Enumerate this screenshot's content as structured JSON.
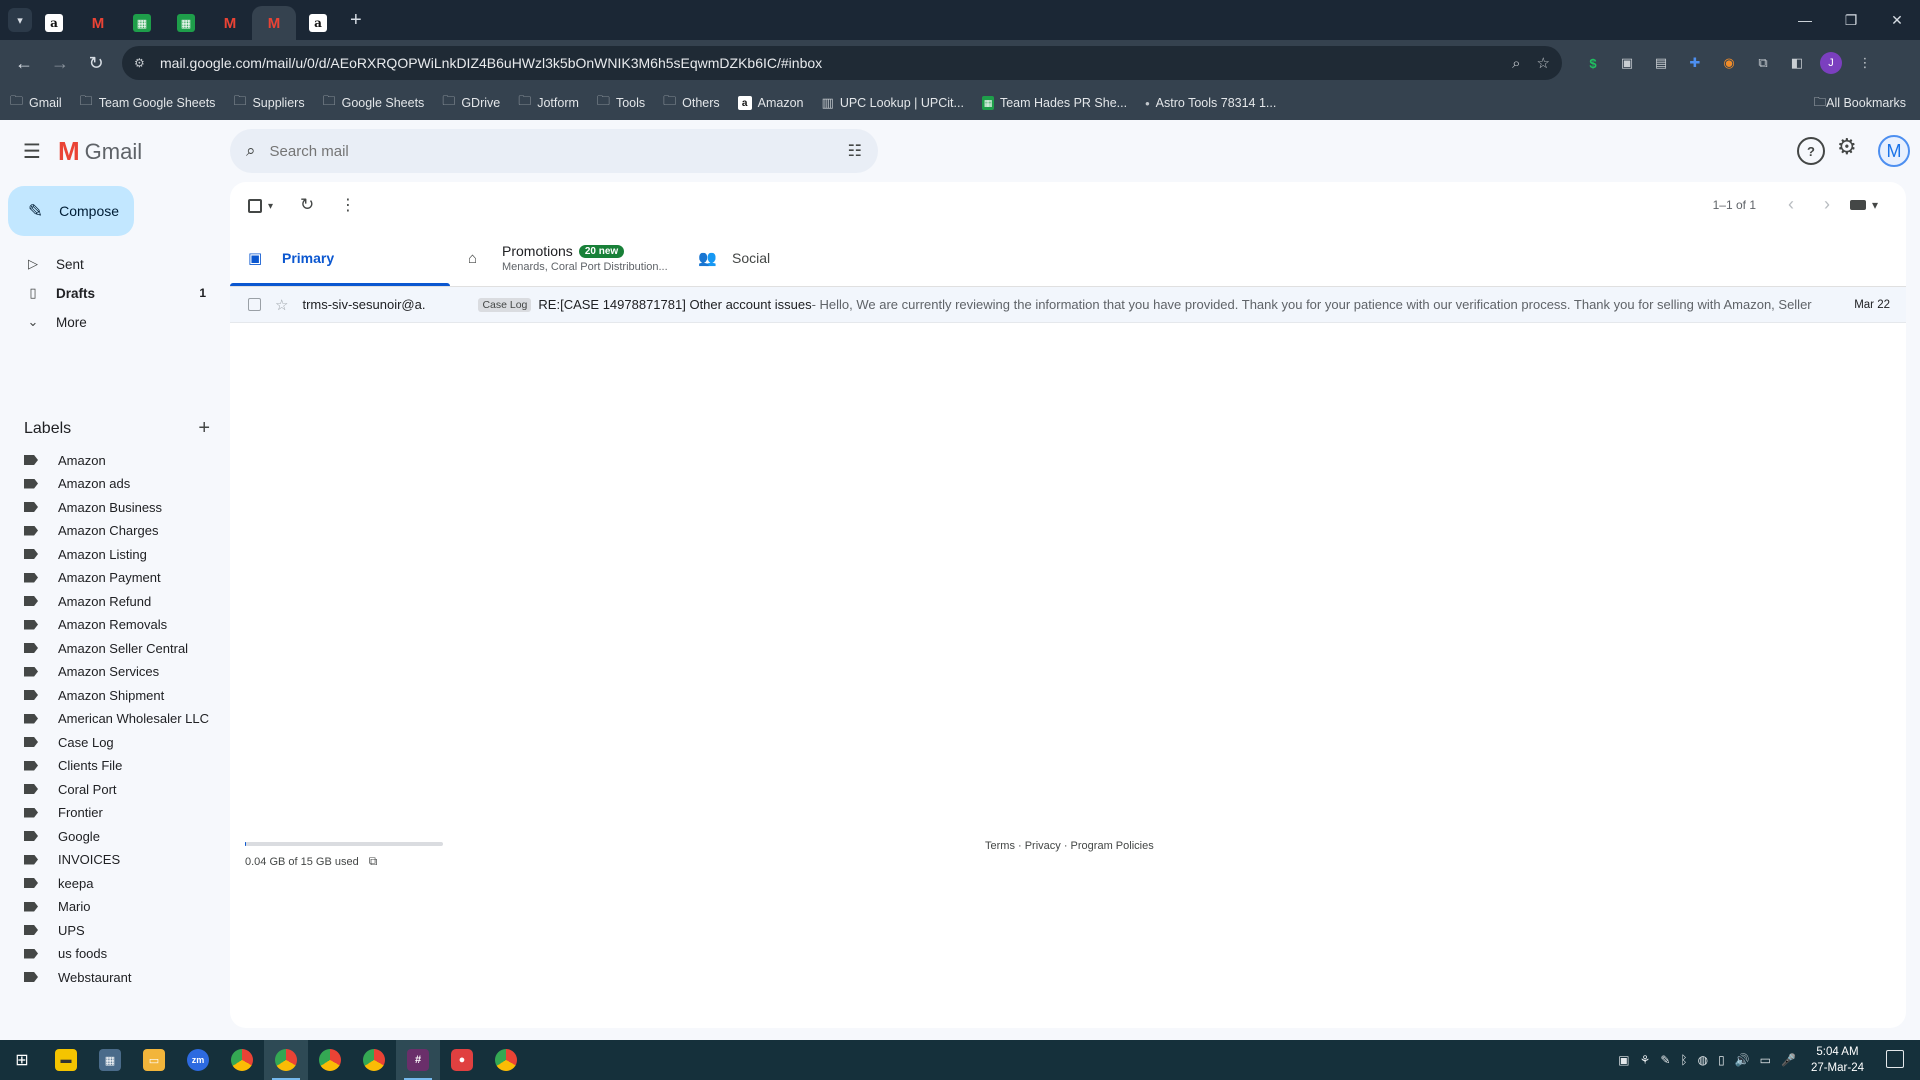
{
  "browser": {
    "url": "mail.google.com/mail/u/0/d/AEoRXRQOPWiLnkDIZ4B6uHWzl3k5bOnWNIK3M6h5sEqwmDZKb6IC/#inbox",
    "bookmarks": [
      {
        "label": "Gmail",
        "icon": "folder-icon"
      },
      {
        "label": "Team Google Sheets",
        "icon": "folder-icon"
      },
      {
        "label": "Suppliers",
        "icon": "folder-icon"
      },
      {
        "label": "Google Sheets",
        "icon": "folder-icon"
      },
      {
        "label": "GDrive",
        "icon": "folder-icon"
      },
      {
        "label": "Jotform",
        "icon": "folder-icon"
      },
      {
        "label": "Tools",
        "icon": "folder-icon"
      },
      {
        "label": "Others",
        "icon": "folder-icon"
      },
      {
        "label": "Amazon",
        "icon": "amazon-icon"
      },
      {
        "label": "UPC Lookup | UPCit...",
        "icon": "barcode-icon"
      },
      {
        "label": "Team Hades PR She...",
        "icon": "sheets-icon"
      },
      {
        "label": "Astro Tools 78314 1...",
        "icon": "dot-icon"
      }
    ],
    "all_bookmarks": "All Bookmarks",
    "profile_initial": "J"
  },
  "gmail": {
    "app_name": "Gmail",
    "search_placeholder": "Search mail",
    "compose_label": "Compose",
    "avatar_initial": "M",
    "nav": {
      "sent": "Sent",
      "drafts": "Drafts",
      "drafts_count": "1",
      "more": "More"
    },
    "labels_title": "Labels",
    "labels": [
      "Amazon",
      "Amazon ads",
      "Amazon Business",
      "Amazon Charges",
      "Amazon Listing",
      "Amazon Payment",
      "Amazon Refund",
      "Amazon Removals",
      "Amazon Seller Central",
      "Amazon Services",
      "Amazon Shipment",
      "American Wholesaler LLC",
      "Case Log",
      "Clients File",
      "Coral Port",
      "Frontier",
      "Google",
      "INVOICES",
      "keepa",
      "Mario",
      "UPS",
      "us foods",
      "Webstaurant"
    ],
    "pager": "1–1 of 1",
    "tabs": {
      "primary": "Primary",
      "promotions": "Promotions",
      "promotions_badge": "20 new",
      "promotions_sub": "Menards, Coral Port Distribution...",
      "social": "Social"
    },
    "email": {
      "sender": "trms-siv-sesunoir@a.",
      "label": "Case Log",
      "subject": "RE:[CASE 14978871781] Other account issues",
      "snippet": " - Hello, We are currently reviewing the information that you have provided. Thank you for your patience with our verification process. Thank you for selling with Amazon, Seller I...",
      "date": "Mar 22"
    },
    "storage": "0.04 GB of 15 GB used",
    "storage_fraction": 0.003,
    "footer": "Terms · Privacy · Program Policies"
  },
  "taskbar": {
    "time": "5:04 AM",
    "date": "27-Mar-24"
  }
}
